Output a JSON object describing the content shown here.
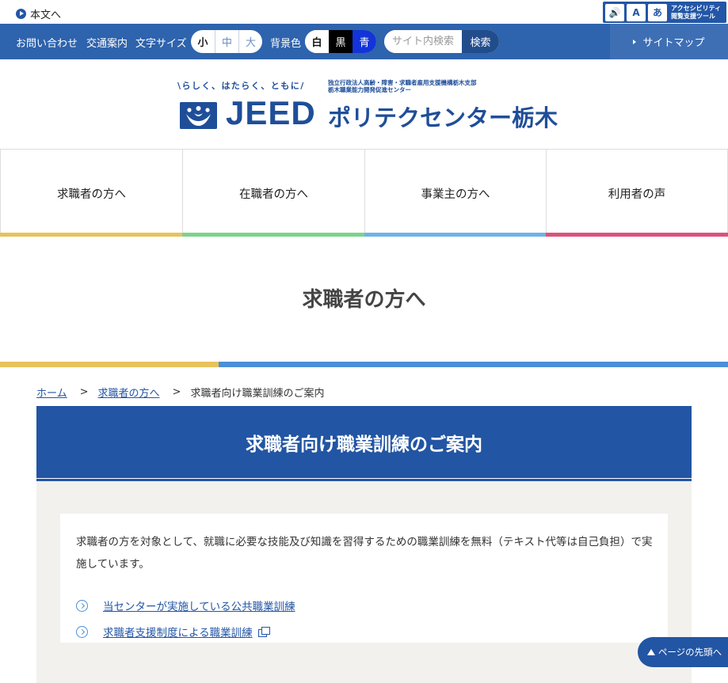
{
  "skip_link": "本文へ",
  "a11y_tool": {
    "label_line1": "アクセシビリティ",
    "label_line2": "閲覧支援ツール",
    "glyph_speaker": "🔊",
    "glyph_a": "A",
    "glyph_hira": "あ"
  },
  "utility": {
    "contact": "お問い合わせ",
    "access": "交通案内",
    "font_size_label": "文字サイズ",
    "font_sizes": [
      "小",
      "中",
      "大"
    ],
    "bg_color_label": "背景色",
    "bg_colors": [
      "白",
      "黒",
      "青"
    ],
    "search_placeholder": "サイト内検索",
    "search_button": "検索",
    "sitemap": "サイトマップ"
  },
  "logo": {
    "tagline": "\\らしく、はたらく、ともに/",
    "org_line1": "独立行政法人高齢・障害・求職者雇用支援機構栃木支部",
    "org_line2": "栃木職業能力開発促進センター",
    "brand": "JEED",
    "center_name": "ポリテクセンター栃木"
  },
  "gnav": [
    {
      "label": "求職者の方へ",
      "color": "#e8c25c"
    },
    {
      "label": "在職者の方へ",
      "color": "#7dd38a"
    },
    {
      "label": "事業主の方へ",
      "color": "#6fb2e6"
    },
    {
      "label": "利用者の声",
      "color": "#d9547a"
    }
  ],
  "page_title": "求職者の方へ",
  "breadcrumb": {
    "home": "ホーム",
    "parent": "求職者の方へ",
    "separator": ">",
    "current": "求職者向け職業訓練のご案内"
  },
  "section": {
    "heading": "求職者向け職業訓練のご案内",
    "intro": "求職者の方を対象として、就職に必要な技能及び知識を習得するための職業訓練を無料（テキスト代等は自己負担）で実施しています。",
    "links": [
      "当センターが実施している公共職業訓練",
      "求職者支援制度による職業訓練"
    ]
  },
  "to_top": "ページの先頭へ"
}
